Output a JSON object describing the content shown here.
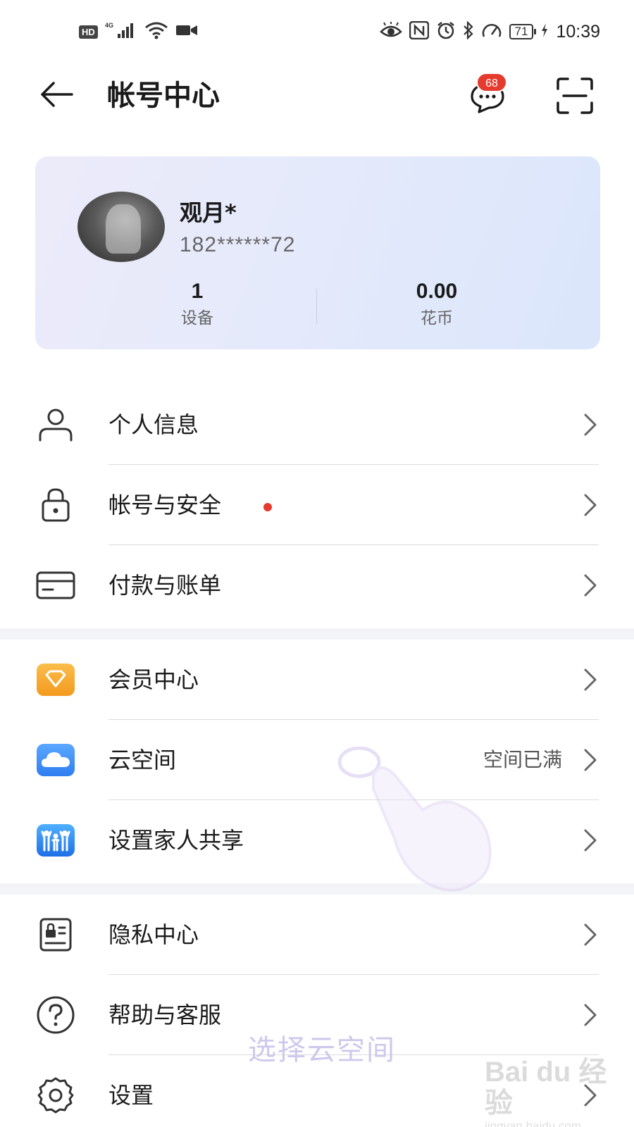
{
  "status_bar": {
    "hd": "HD",
    "network": "4G",
    "battery": "71",
    "time": "10:39"
  },
  "header": {
    "title": "帐号中心",
    "message_badge": "68"
  },
  "profile": {
    "name": "观月*",
    "phone": "182******72",
    "stats": [
      {
        "value": "1",
        "label": "设备"
      },
      {
        "value": "0.00",
        "label": "花币"
      }
    ]
  },
  "menu": {
    "personal_info": "个人信息",
    "account_security": "帐号与安全",
    "payment_billing": "付款与账单",
    "membership": "会员中心",
    "cloud_space": "云空间",
    "cloud_space_status": "空间已满",
    "family_sharing": "设置家人共享",
    "privacy_center": "隐私中心",
    "help_service": "帮助与客服",
    "settings": "设置"
  },
  "overlay": {
    "hint_caption": "选择云空间",
    "watermark_logo": "Bai du 经验",
    "watermark_url": "jingyan.baidu.com"
  },
  "colors": {
    "accent_red": "#e53b2e",
    "card_gradient_start": "#ecebfa",
    "card_gradient_end": "#dbe6fb",
    "membership_orange": "#f7a52b",
    "cloud_blue": "#3b8cf5"
  },
  "icons": {
    "back": "arrow-left-icon",
    "message": "chat-bubble-icon",
    "scan": "scan-frame-icon",
    "personal_info": "person-icon",
    "account_security": "lock-icon",
    "payment_billing": "card-icon",
    "membership": "diamond-icon",
    "cloud_space": "cloud-icon",
    "family_sharing": "family-icon",
    "privacy_center": "id-card-lock-icon",
    "help_service": "question-icon",
    "settings": "gear-icon",
    "chevron": "chevron-right-icon"
  }
}
